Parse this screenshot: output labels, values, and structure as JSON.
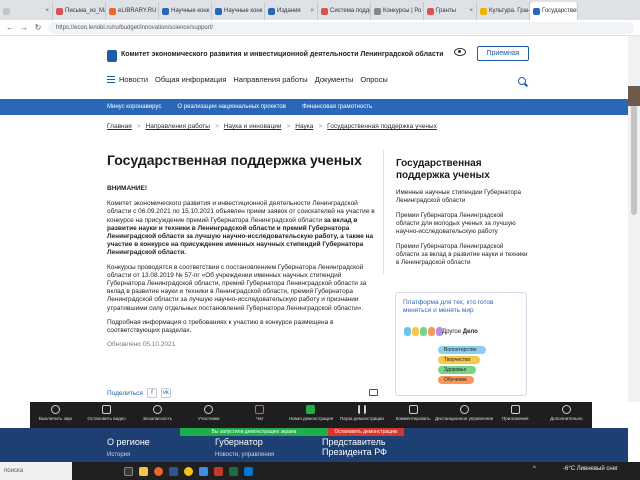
{
  "browser": {
    "tabs": [
      {
        "label": "",
        "color": "#c4c4c4",
        "active": false
      },
      {
        "label": "Письма_из_Малор",
        "color": "#d9534f",
        "active": false
      },
      {
        "label": "eLIBRARY.RU –",
        "color": "#e8672a",
        "active": false
      },
      {
        "label": "Научные конк",
        "color": "#2b67b8",
        "active": false
      },
      {
        "label": "Научные конк",
        "color": "#2b67b8",
        "active": false
      },
      {
        "label": "Издания",
        "color": "#2b67b8",
        "active": false
      },
      {
        "label": "Система подде",
        "color": "#d9534f",
        "active": false
      },
      {
        "label": "Конкурсы | Ро",
        "color": "#888888",
        "active": false
      },
      {
        "label": "Гранты",
        "color": "#d9534f",
        "active": false
      },
      {
        "label": "Культура. Гран",
        "color": "#f0b400",
        "active": false
      },
      {
        "label": "Государствен",
        "color": "#2b67b8",
        "active": true
      }
    ],
    "url": "https://econ.lenobl.ru/ru/budget/innovation/science/support/"
  },
  "header": {
    "org_title": "Комитет экономического развития и инвестиционной деятельности Ленинградской области",
    "reception_button": "Приемная",
    "menu": [
      "Новости",
      "Общая информация",
      "Направления работы",
      "Документы",
      "Опросы"
    ]
  },
  "bluebar": [
    "Минус коронавирус",
    "О реализации национальных проектов",
    "Финансовая грамотность"
  ],
  "breadcrumb": [
    "Главная",
    "Направления работы",
    "Наука и инновации",
    "Наука",
    "Государственная поддержка ученых"
  ],
  "article": {
    "title": "Государственная поддержка ученых",
    "warning": "ВНИМАНИЕ!",
    "p1_normal": "Комитет экономического развития и инвестиционной деятельности Ленинградской области с 06.09.2021 по 15.10.2021 объявлен прием заявок от соискателей на участие в конкурсе на присуждение премий Губернатора Ленинградской области ",
    "p1_bold": "за вклад в развитие науки и техники в Ленинградской области и премий Губернатора Ленинградской области за лучшую научно-исследовательскую работу, а также на участие в конкурсе на присуждение именных научных стипендий Губернатора Ленинградской области.",
    "p2": "Конкурсы проводятся в соответствии с постановлением Губернатора Ленинградской области от 13.08.2019 № 57-пг «Об учреждении именных научных стипендий Губернатора Ленинградской области, премий Губернатора Ленинградской области за вклад в развитие науки и техники в Ленинградской области, премий Губернатора Ленинградской области за лучшую научно-исследовательскую работу и признании утратившими силу отдельных постановлений Губернатора Ленинградской области».",
    "p3": "Подробная информация о требованиях к участию в конкурсе размещена в соответствующих разделах.",
    "updated": "Обновлено 05.10.2021",
    "share_label": "Поделиться"
  },
  "sidebar": {
    "title": "Государственная поддержка ученых",
    "links": [
      "Именные научные стипендии Губернатора Ленинградской области",
      "Премии Губернатора Ленинградской области для молодых ученых за лучшую научно-исследовательскую работу",
      "Премии Губернатора Ленинградской области за вклад в развитие науки и техники в Ленинградской области"
    ],
    "promo": {
      "text": "Платформа для тех, кто готов меняться и менять мир",
      "brand_prefix": "Другое",
      "brand_bold": "Дело",
      "pills": [
        {
          "label": "Волонтерство",
          "color": "#8ad1f0"
        },
        {
          "label": "Творчество",
          "color": "#f5c94a"
        },
        {
          "label": "Здоровье",
          "color": "#7ad387"
        },
        {
          "label": "Обучение",
          "color": "#f59a5a"
        }
      ]
    }
  },
  "zoombar": [
    "Выключить звук",
    "Остановить видео",
    "Безопасность",
    "Участники",
    "Чат",
    "Новая демонстрация",
    "Пауза демонстрации",
    "Комментировать",
    "Дистанционное управление",
    "Приложения",
    "Дополнительно"
  ],
  "share_banner": {
    "status": "Вы запустили демонстрацию экрана",
    "stop": "Остановить демонстрацию"
  },
  "footer": {
    "col1": "О регионе",
    "col1_sub": "История",
    "col2": "Губернатор",
    "col2_sub": "Новости, управления",
    "col3": "Представитель Президента РФ"
  },
  "taskbar": {
    "search_placeholder": "поиска",
    "weather": "-6°C  Ливневый снег",
    "tray": "^"
  }
}
